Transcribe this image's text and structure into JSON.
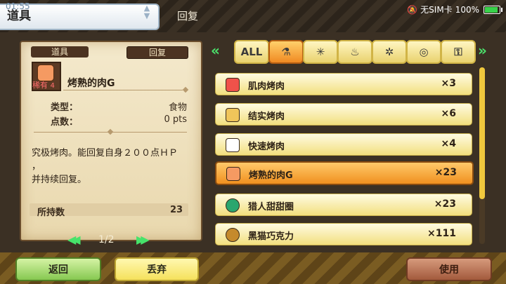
{
  "status_bar": {
    "time": "01:55",
    "carrier": "无SIM卡",
    "battery": "100%"
  },
  "header": {
    "title": "道具",
    "subtitle": "回复"
  },
  "detail": {
    "category_label": "道具",
    "subcategory_label": "回复",
    "rarity_label": "稀有",
    "rarity_value": "4",
    "item_name": "烤熟的肉G",
    "type_label": "类型：",
    "type_value": "食物",
    "points_label": "点数：",
    "points_value": "0 pts",
    "description_line1": "究极烤肉。能回复自身２００点ＨＰ",
    "description_line2": "，",
    "description_line3": "并持续回复。",
    "owned_label": "所持数",
    "owned_value": "23",
    "pager": "1/2"
  },
  "tabs": [
    {
      "name": "all",
      "label": "ALL",
      "icon": "all-icon"
    },
    {
      "name": "potion",
      "label": "",
      "icon": "bottle-icon"
    },
    {
      "name": "ammo",
      "label": "",
      "icon": "spark-icon"
    },
    {
      "name": "bag",
      "label": "",
      "icon": "bag-icon"
    },
    {
      "name": "bug",
      "label": "",
      "icon": "bug-icon"
    },
    {
      "name": "egg",
      "label": "",
      "icon": "egg-icon"
    },
    {
      "name": "key",
      "label": "",
      "icon": "key-icon"
    }
  ],
  "items": [
    {
      "name": "肌肉烤肉",
      "count": "×3",
      "icon_color": "#f0524a"
    },
    {
      "name": "结实烤肉",
      "count": "×6",
      "icon_color": "#f0c55a"
    },
    {
      "name": "快速烤肉",
      "count": "×4",
      "icon_color": "#ffffff"
    },
    {
      "name": "烤熟的肉G",
      "count": "×23",
      "icon_color": "#f59a62"
    },
    {
      "name": "猎人甜甜圈",
      "count": "×23",
      "icon_color": "#2aa66e"
    },
    {
      "name": "黑猫巧克力",
      "count": "×111",
      "icon_color": "#c58a2c"
    }
  ],
  "selected_item_index": 3,
  "buttons": {
    "back": "返回",
    "discard": "丢弃",
    "use": "使用"
  }
}
